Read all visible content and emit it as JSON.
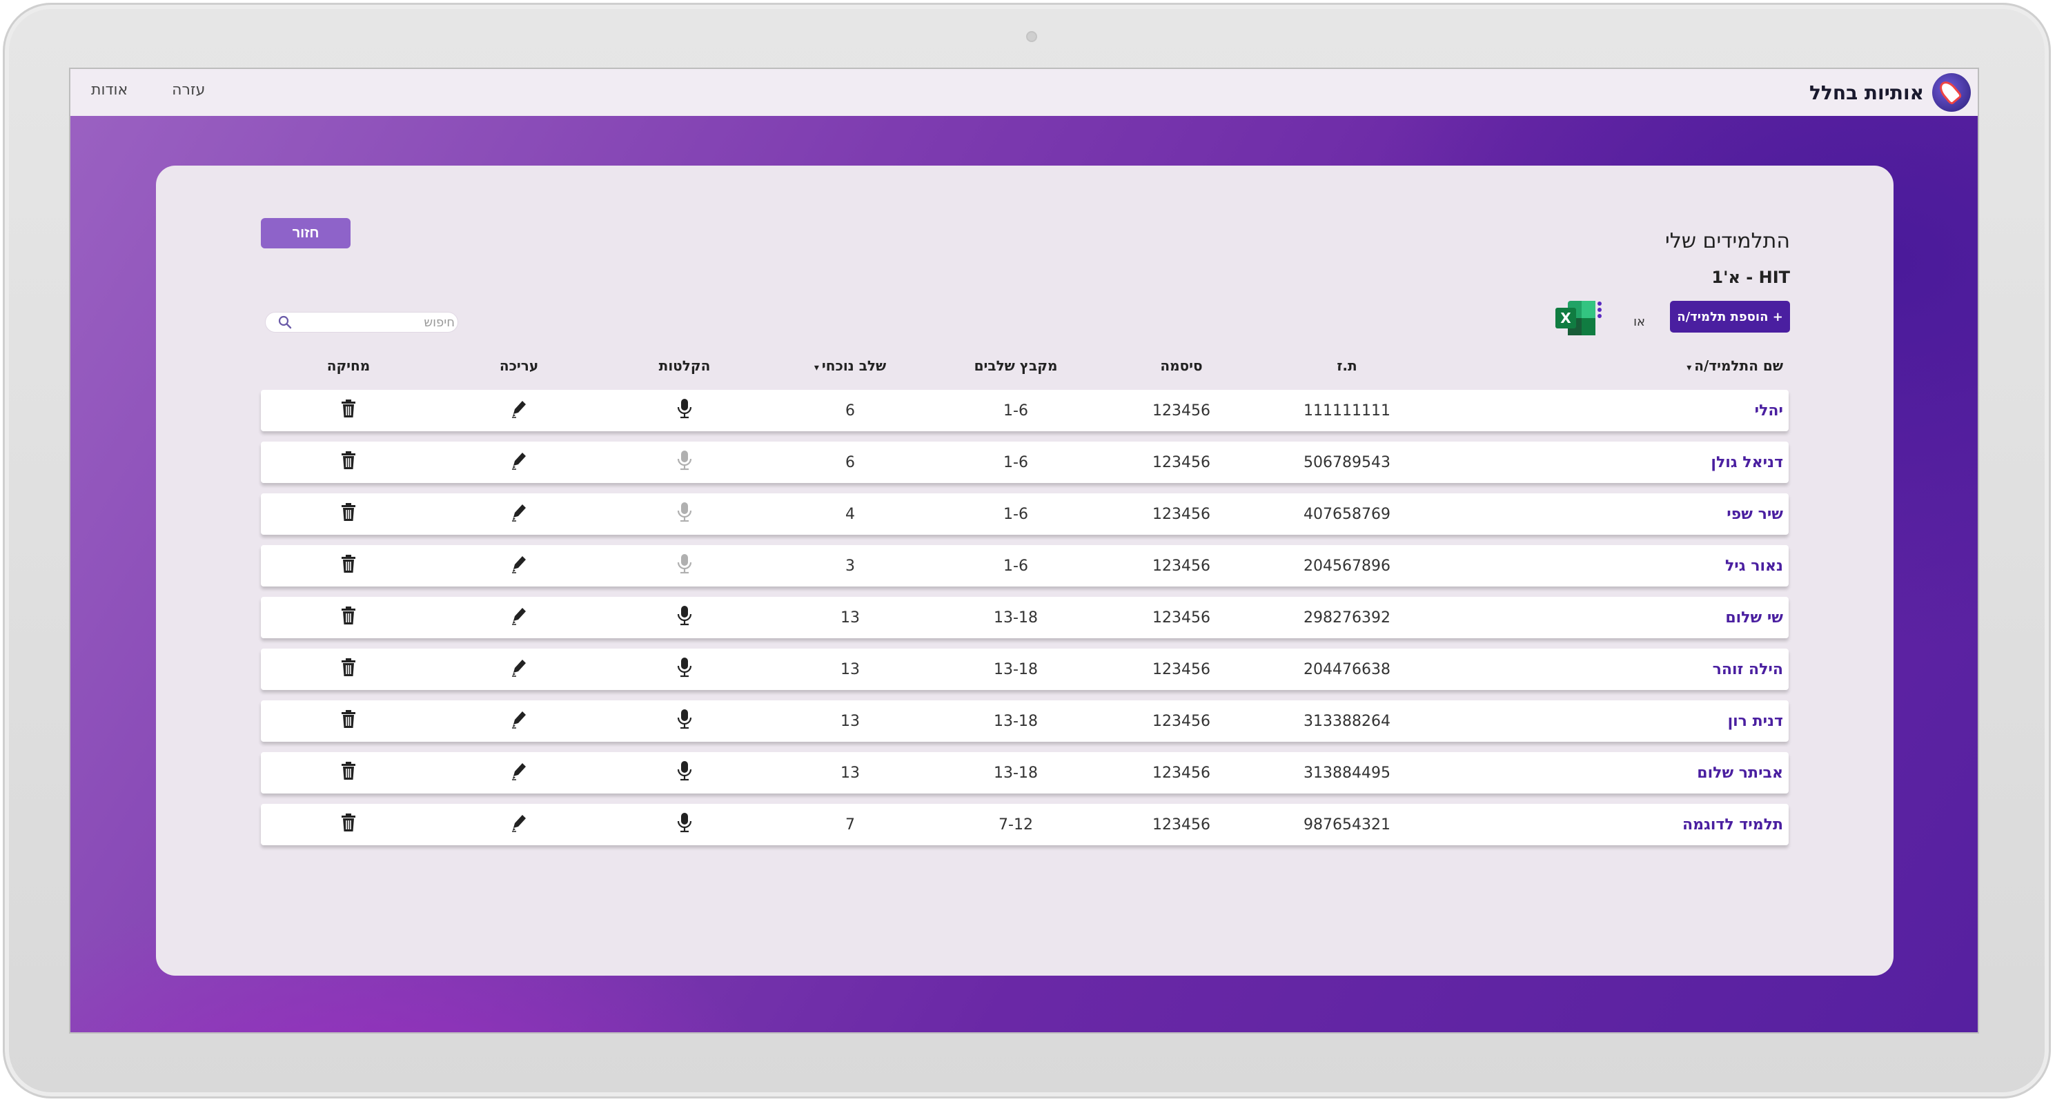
{
  "app": {
    "logo_text": "אותיות בחלל",
    "nav": {
      "about": "אודות",
      "help": "עזרה"
    }
  },
  "page": {
    "title": "התלמידים שלי",
    "class_name": "HIT - א'1",
    "back_label": "חזור",
    "add_student_label": "+ הוספת תלמיד/ה",
    "or_label": "או",
    "search_placeholder": "חיפוש"
  },
  "table": {
    "headers": {
      "name": "שם התלמיד/ה",
      "id": "ת.ז",
      "password": "סיסמה",
      "stage_group": "מקבץ שלבים",
      "current_stage": "שלב נוכחי",
      "recordings": "הקלטות",
      "edit": "עריכה",
      "delete": "מחיקה"
    },
    "rows": [
      {
        "name": "יהלי",
        "id": "111111111",
        "password": "123456",
        "stage_group": "1-6",
        "current_stage": "6",
        "has_recordings": true
      },
      {
        "name": "דניאל גולן",
        "id": "506789543",
        "password": "123456",
        "stage_group": "1-6",
        "current_stage": "6",
        "has_recordings": false
      },
      {
        "name": "שיר שפי",
        "id": "407658769",
        "password": "123456",
        "stage_group": "1-6",
        "current_stage": "4",
        "has_recordings": false
      },
      {
        "name": "נאור גיל",
        "id": "204567896",
        "password": "123456",
        "stage_group": "1-6",
        "current_stage": "3",
        "has_recordings": false
      },
      {
        "name": "שי שלום",
        "id": "298276392",
        "password": "123456",
        "stage_group": "13-18",
        "current_stage": "13",
        "has_recordings": true
      },
      {
        "name": "הילה זוהר",
        "id": "204476638",
        "password": "123456",
        "stage_group": "13-18",
        "current_stage": "13",
        "has_recordings": true
      },
      {
        "name": "דנית רון",
        "id": "313388264",
        "password": "123456",
        "stage_group": "13-18",
        "current_stage": "13",
        "has_recordings": true
      },
      {
        "name": "אביתר שלום",
        "id": "313884495",
        "password": "123456",
        "stage_group": "13-18",
        "current_stage": "13",
        "has_recordings": true
      },
      {
        "name": "תלמיד לדוגמה",
        "id": "987654321",
        "password": "123456",
        "stage_group": "7-12",
        "current_stage": "7",
        "has_recordings": true
      }
    ]
  },
  "colors": {
    "accent": "#4a1fa0",
    "back_button": "#8e63c9",
    "mic_disabled": "#b0b0b0",
    "excel_green": "#1d7a45"
  },
  "icons": {
    "search": "search-icon",
    "microphone": "microphone-icon",
    "edit": "pencil-icon",
    "delete": "trash-icon",
    "excel": "excel-icon",
    "sort": "sort-caret-icon"
  }
}
